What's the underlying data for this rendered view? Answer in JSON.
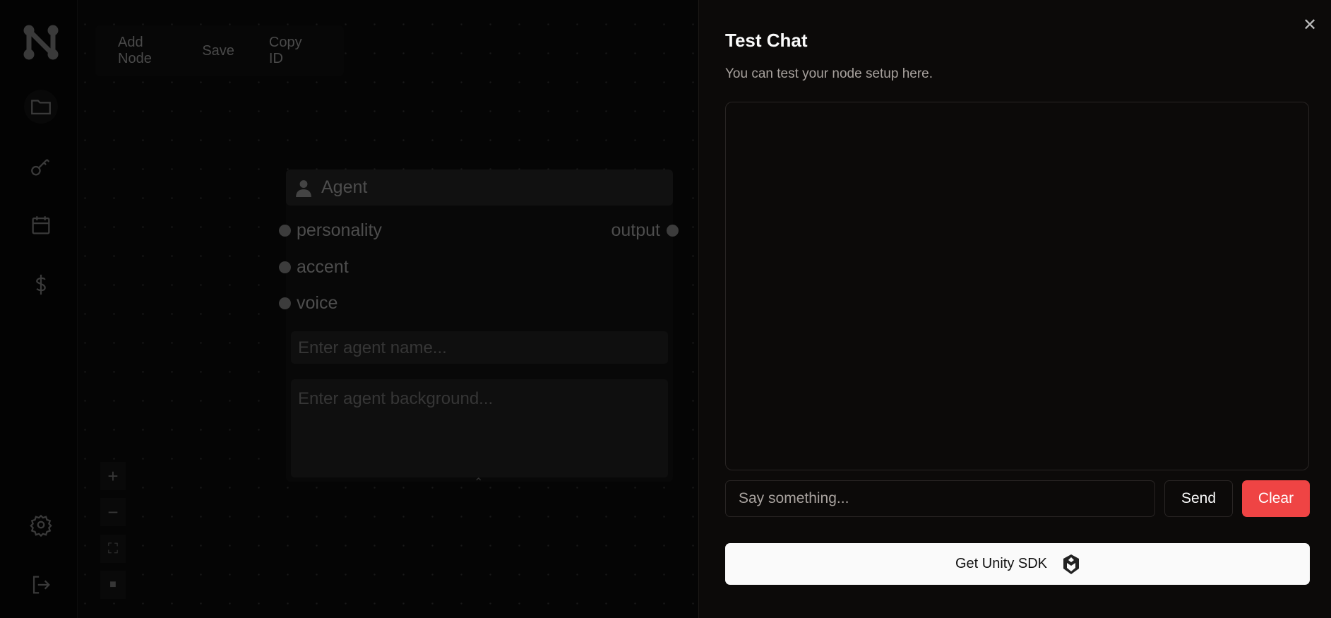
{
  "toolbar": {
    "add_node": "Add Node",
    "save": "Save",
    "copy_id": "Copy ID"
  },
  "sidebar": {
    "items": [
      "folder-icon",
      "key-icon",
      "calendar-icon",
      "dollar-icon",
      "settings-icon",
      "logout-icon"
    ]
  },
  "node": {
    "title": "Agent",
    "inputs": [
      "personality",
      "accent",
      "voice"
    ],
    "output": "output",
    "name_placeholder": "Enter agent name...",
    "background_placeholder": "Enter agent background..."
  },
  "panel": {
    "title": "Test Chat",
    "subtitle": "You can test your node setup here.",
    "input_placeholder": "Say something...",
    "send": "Send",
    "clear": "Clear",
    "unity": "Get Unity SDK"
  },
  "colors": {
    "clear": "#ef4444",
    "panel_bg": "#0c0a09"
  }
}
